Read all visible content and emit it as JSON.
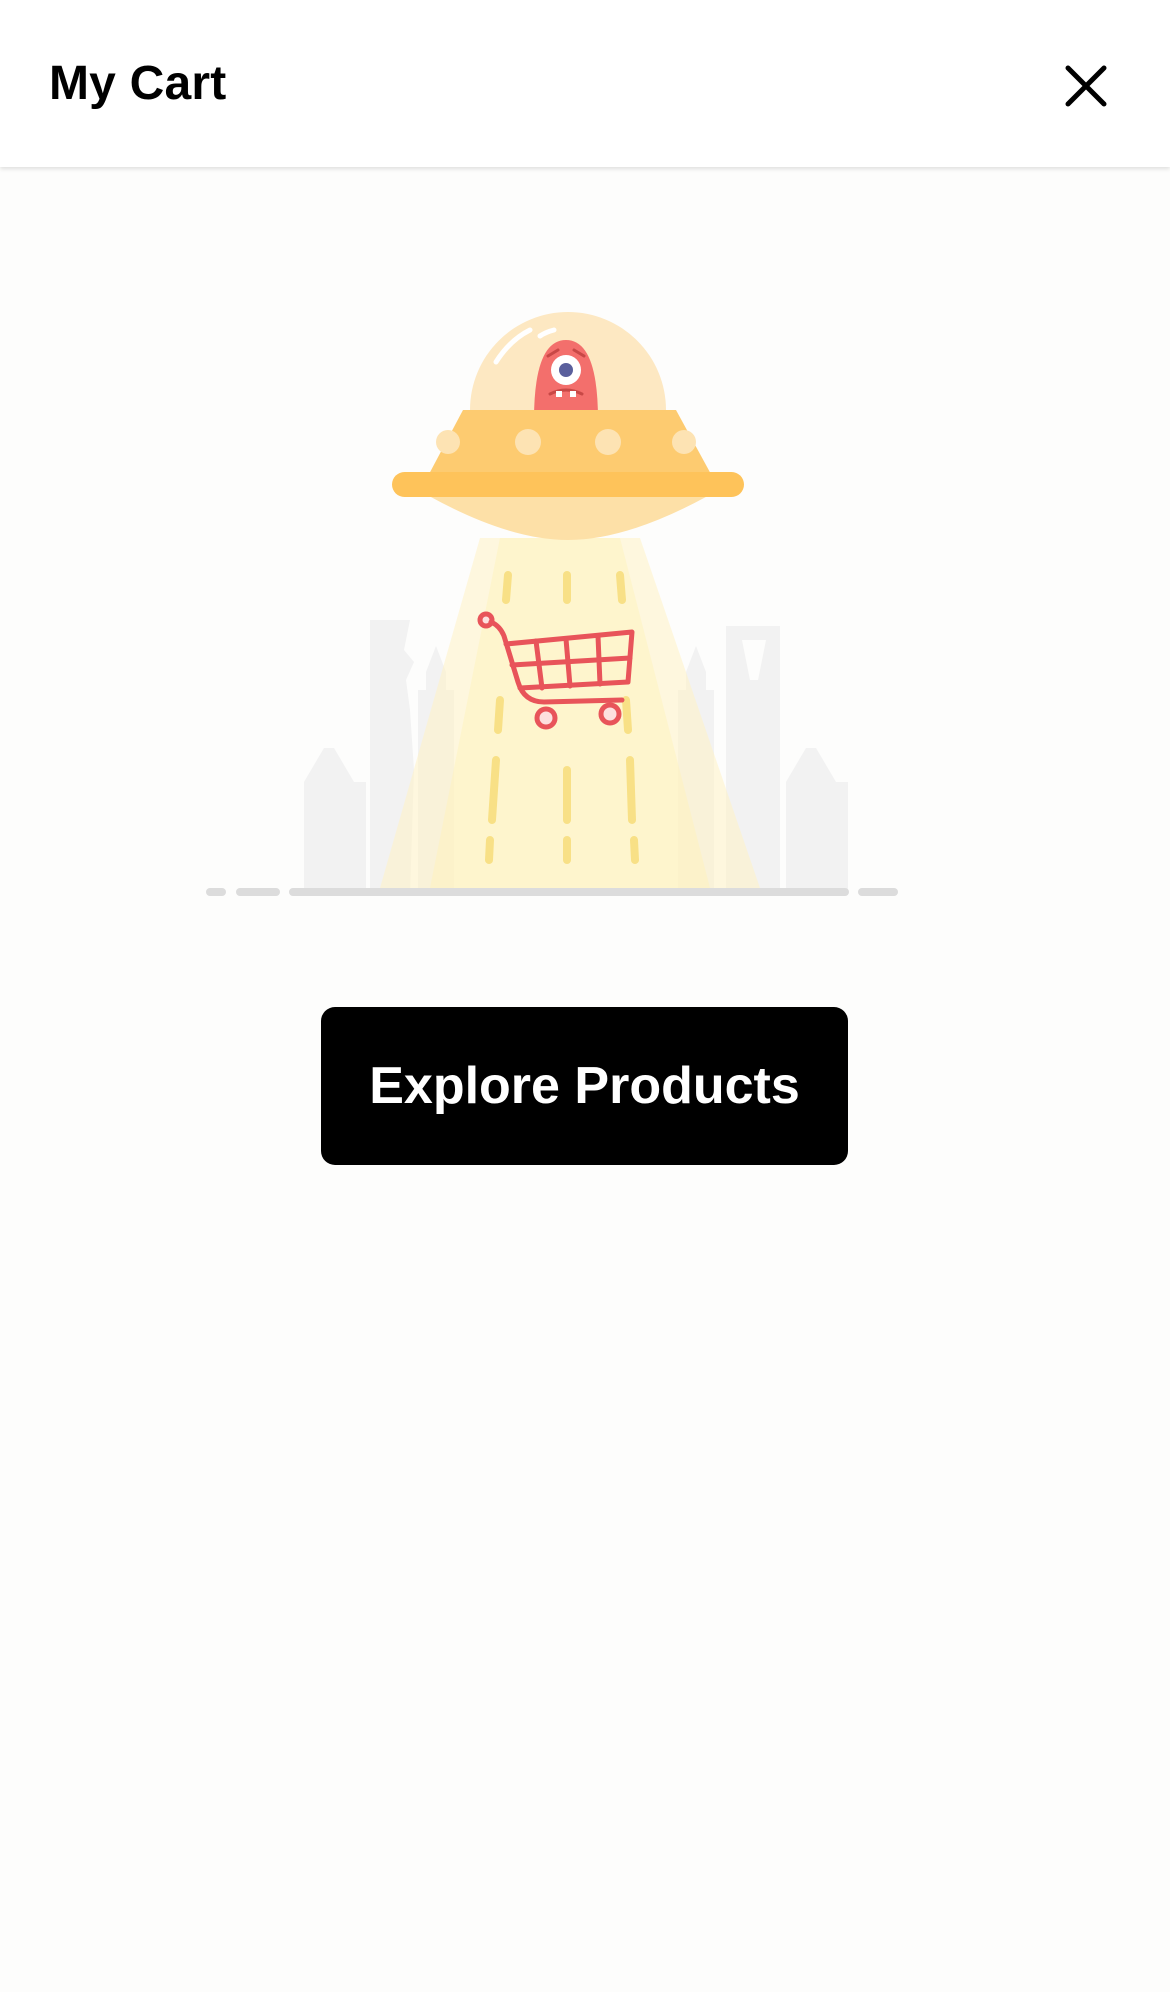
{
  "header": {
    "title": "My Cart",
    "close_icon": "close-icon"
  },
  "empty_state": {
    "illustration": "ufo-abducting-shopping-cart",
    "explore_button_label": "Explore Products"
  },
  "colors": {
    "background": "#fdfdfc",
    "header_background": "#ffffff",
    "button_background": "#000000",
    "button_text": "#ffffff",
    "ufo_yellow": "#fec35a",
    "alien_red": "#f36f6c"
  }
}
